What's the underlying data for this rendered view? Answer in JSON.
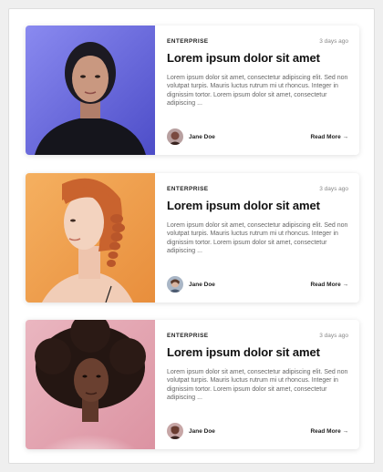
{
  "cards": [
    {
      "category": "ENTERPRISE",
      "date": "3 days ago",
      "title": "Lorem ipsum dolor sit amet",
      "excerpt": "Lorem ipsum dolor sit amet, consectetur adipiscing elit. Sed non volutpat turpis. Mauris luctus rutrum mi ut rhoncus. Integer in dignissim tortor. Lorem ipsum dolor sit amet, consectetur adipiscing ...",
      "author": "Jane Doe",
      "read_more": "Read More →",
      "image_colors": {
        "background": "#6f6fe0",
        "skin": "#c99880",
        "hair": "#1c1a22"
      }
    },
    {
      "category": "ENTERPRISE",
      "date": "3 days ago",
      "title": "Lorem ipsum dolor sit amet",
      "excerpt": "Lorem ipsum dolor sit amet, consectetur adipiscing elit. Sed non volutpat turpis. Mauris luctus rutrum mi ut rhoncus. Integer in dignissim tortor. Lorem ipsum dolor sit amet, consectetur adipiscing ...",
      "author": "Jane Doe",
      "read_more": "Read More →",
      "image_colors": {
        "background": "#f0a050",
        "skin": "#f3d3bf",
        "hair": "#c9632e"
      }
    },
    {
      "category": "ENTERPRISE",
      "date": "3 days ago",
      "title": "Lorem ipsum dolor sit amet",
      "excerpt": "Lorem ipsum dolor sit amet, consectetur adipiscing elit. Sed non volutpat turpis. Mauris luctus rutrum mi ut rhoncus. Integer in dignissim tortor. Lorem ipsum dolor sit amet, consectetur adipiscing ...",
      "author": "Jane Doe",
      "read_more": "Read More →",
      "image_colors": {
        "background": "#e8a6b4",
        "skin": "#6a4030",
        "hair": "#241612"
      }
    }
  ]
}
